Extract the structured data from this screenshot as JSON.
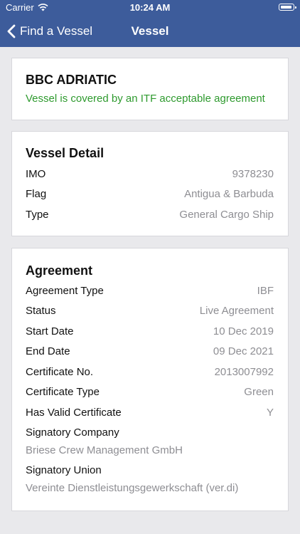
{
  "status_bar": {
    "carrier": "Carrier",
    "time": "10:24 AM"
  },
  "nav": {
    "back_label": "Find a Vessel",
    "title": "Vessel"
  },
  "vessel": {
    "name": "BBC ADRIATIC",
    "coverage": "Vessel is covered by an ITF acceptable agreement",
    "coverage_color": "#2e9a2e"
  },
  "vessel_detail": {
    "title": "Vessel Detail",
    "rows": [
      {
        "label": "IMO",
        "value": "9378230"
      },
      {
        "label": "Flag",
        "value": "Antigua & Barbuda"
      },
      {
        "label": "Type",
        "value": "General Cargo Ship"
      }
    ]
  },
  "agreement": {
    "title": "Agreement",
    "rows": [
      {
        "label": "Agreement Type",
        "value": "IBF"
      },
      {
        "label": "Status",
        "value": "Live Agreement"
      },
      {
        "label": "Start Date",
        "value": "10 Dec 2019"
      },
      {
        "label": "End Date",
        "value": "09 Dec 2021"
      },
      {
        "label": "Certificate No.",
        "value": "2013007992"
      },
      {
        "label": "Certificate Type",
        "value": "Green"
      },
      {
        "label": "Has Valid Certificate",
        "value": "Y"
      }
    ],
    "signatory_company_label": "Signatory Company",
    "signatory_company_value": "Briese Crew Management GmbH",
    "signatory_union_label": "Signatory Union",
    "signatory_union_value": "Vereinte Dienstleistungsgewerkschaft (ver.di)"
  },
  "colors": {
    "nav_bg": "#3d5c9b",
    "page_bg": "#e9e9ec",
    "value_gray": "#8e8e93"
  }
}
